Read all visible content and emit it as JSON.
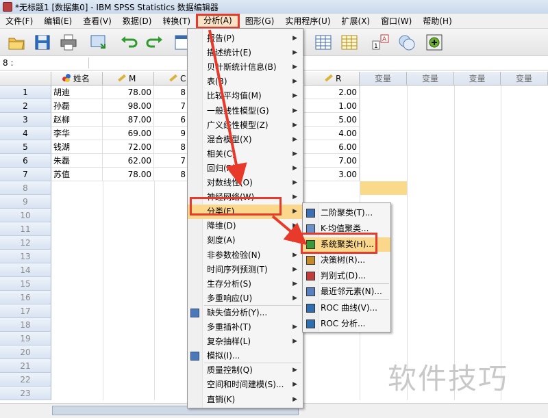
{
  "window": {
    "title": "*无标题1 [数据集0] - IBM SPSS Statistics 数据编辑器"
  },
  "menubar": [
    {
      "label": "文件(F)"
    },
    {
      "label": "编辑(E)"
    },
    {
      "label": "查看(V)"
    },
    {
      "label": "数据(D)"
    },
    {
      "label": "转换(T)"
    },
    {
      "label": "分析(A)"
    },
    {
      "label": "图形(G)"
    },
    {
      "label": "实用程序(U)"
    },
    {
      "label": "扩展(X)"
    },
    {
      "label": "窗口(W)"
    },
    {
      "label": "帮助(H)"
    }
  ],
  "cellbar": {
    "ref": "8 :"
  },
  "columns": [
    {
      "label": "姓名",
      "icon": "nominal-icon"
    },
    {
      "label": "M",
      "icon": "scale-ruler-icon"
    },
    {
      "label": "C",
      "icon": "scale-ruler-icon"
    },
    {
      "label": "R",
      "icon": "scale-ruler-icon"
    },
    {
      "label": "变量"
    },
    {
      "label": "变量"
    },
    {
      "label": "变量"
    },
    {
      "label": "变量"
    }
  ],
  "rows": [
    {
      "n": "1",
      "name": "胡迪",
      "m": "78.00",
      "c": "8",
      "r": "2.00"
    },
    {
      "n": "2",
      "name": "孙磊",
      "m": "98.00",
      "c": "7",
      "r": "1.00"
    },
    {
      "n": "3",
      "name": "赵柳",
      "m": "87.00",
      "c": "6",
      "r": "5.00"
    },
    {
      "n": "4",
      "name": "李华",
      "m": "69.00",
      "c": "9",
      "r": "4.00"
    },
    {
      "n": "5",
      "name": "钱湖",
      "m": "72.00",
      "c": "8",
      "r": "6.00"
    },
    {
      "n": "6",
      "name": "朱磊",
      "m": "62.00",
      "c": "7",
      "r": "7.00"
    },
    {
      "n": "7",
      "name": "苏值",
      "m": "78.00",
      "c": "8",
      "r": "3.00"
    }
  ],
  "hidden_cells": {
    "r_col_prefix": [
      "0",
      "0",
      "0",
      "0",
      "0",
      "0",
      "0"
    ]
  },
  "empty_rows": [
    "8",
    "9",
    "10",
    "11",
    "12",
    "13",
    "14",
    "15",
    "16",
    "17",
    "18",
    "19",
    "20",
    "21",
    "22",
    "23"
  ],
  "analyze_menu": [
    {
      "label": "报告(P)",
      "sub": true
    },
    {
      "label": "描述统计(E)",
      "sub": true
    },
    {
      "label": "贝叶斯统计信息(B)",
      "sub": true
    },
    {
      "label": "表(B)",
      "sub": true
    },
    {
      "label": "比较平均值(M)",
      "sub": true
    },
    {
      "label": "一般线性模型(G)",
      "sub": true
    },
    {
      "label": "广义线性模型(Z)",
      "sub": true
    },
    {
      "label": "混合模型(X)",
      "sub": true
    },
    {
      "label": "相关(C)",
      "sub": true
    },
    {
      "label": "回归(R)",
      "sub": true
    },
    {
      "label": "对数线性(O)",
      "sub": true
    },
    {
      "label": "神经网络(W)",
      "sub": true
    },
    {
      "label": "分类(F)",
      "sub": true
    },
    {
      "label": "降维(D)",
      "sub": true
    },
    {
      "label": "刻度(A)",
      "sub": true
    },
    {
      "label": "非参数检验(N)",
      "sub": true
    },
    {
      "label": "时间序列预测(T)",
      "sub": true
    },
    {
      "label": "生存分析(S)",
      "sub": true
    },
    {
      "label": "多重响应(U)",
      "sub": true
    },
    {
      "label": "缺失值分析(Y)...",
      "sub": false,
      "icon": "missing-value-icon"
    },
    {
      "label": "多重插补(T)",
      "sub": true
    },
    {
      "label": "复杂抽样(L)",
      "sub": true
    },
    {
      "label": "模拟(I)...",
      "sub": false,
      "icon": "simulation-icon"
    },
    {
      "label": "质量控制(Q)",
      "sub": true
    },
    {
      "label": "空间和时间建模(S)...",
      "sub": true
    },
    {
      "label": "直销(K)",
      "sub": true
    }
  ],
  "classify_menu": [
    {
      "label": "二阶聚类(T)...",
      "icon": "twostep-cluster-icon"
    },
    {
      "label": "K-均值聚类...",
      "icon": "kmeans-cluster-icon"
    },
    {
      "label": "系统聚类(H)...",
      "icon": "hierarchical-cluster-icon"
    },
    {
      "label": "决策树(R)...",
      "icon": "decision-tree-icon"
    },
    {
      "label": "判别式(D)...",
      "icon": "discriminant-icon"
    },
    {
      "label": "最近邻元素(N)...",
      "icon": "nearest-neighbor-icon"
    },
    {
      "label": "ROC 曲线(V)...",
      "icon": "roc-curve-icon"
    },
    {
      "label": "ROC 分析...",
      "icon": "roc-analysis-icon"
    }
  ],
  "watermark": "软件技巧",
  "colors": {
    "highlight_border": "#e83a2a",
    "menu_hover": "#fbd78c",
    "arrow": "#e83a2a"
  }
}
